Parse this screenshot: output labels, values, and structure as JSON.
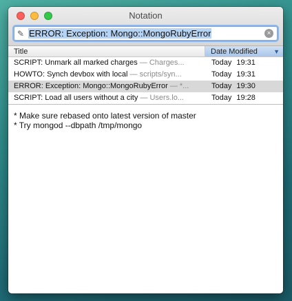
{
  "window": {
    "title": "Notation"
  },
  "search": {
    "value": "ERROR: Exception: Mongo::MongoRubyError",
    "clear_glyph": "×",
    "pencil_glyph": "✎"
  },
  "columns": {
    "title": "Title",
    "date": "Date Modified",
    "sort_glyph": "▼"
  },
  "notes": [
    {
      "title": "SCRIPT: Unmark all marked charges",
      "path": " — Charges...",
      "day": "Today",
      "time": "19:31",
      "selected": false
    },
    {
      "title": "HOWTO: Synch devbox with local",
      "path": " — scripts/syn...",
      "day": "Today",
      "time": "19:31",
      "selected": false
    },
    {
      "title": "ERROR: Exception: Mongo::MongoRubyError",
      "path": " — *...",
      "day": "Today",
      "time": "19:30",
      "selected": true
    },
    {
      "title": "SCRIPT: Load all users without a city",
      "path": " — Users.lo...",
      "day": "Today",
      "time": "19:28",
      "selected": false
    }
  ],
  "note_body": {
    "lines": [
      "* Make sure rebased onto latest version of master",
      "* Try mongod --dbpath /tmp/mongo"
    ]
  },
  "colors": {
    "selection_highlight": "#b4d3f5",
    "selected_row": "#d8d8d8",
    "sorted_column": "#a9c6ea"
  }
}
